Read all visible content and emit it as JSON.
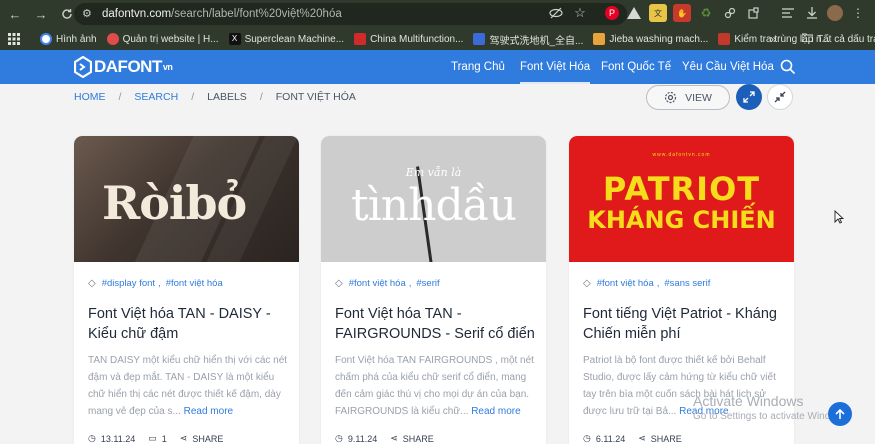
{
  "browser": {
    "url_host": "dafontvn.com",
    "url_path": "/search/label/font%20việt%20hóa",
    "bookmarks": [
      {
        "label": "Hình ảnh",
        "color": "#4caf50"
      },
      {
        "label": "Quản trị website | H...",
        "color": "#e04b4b"
      },
      {
        "label": "Superclean Machine...",
        "color": "#111111"
      },
      {
        "label": "China Multifunction...",
        "color": "#d12a2a"
      },
      {
        "label": "驾驶式洗地机_全自...",
        "color": "#3b6bd8"
      },
      {
        "label": "Jieba washing mach...",
        "color": "#e8a33a"
      },
      {
        "label": "Kiểm tra trùng lặp n...",
        "color": "#c0392b"
      }
    ],
    "bookmarks_more": "»",
    "all_bookmarks": "Tất cả dấu trang"
  },
  "site": {
    "logo_text": "DAFONT",
    "logo_suffix": "vn",
    "menu": [
      {
        "label": "Trang Chủ",
        "active": false
      },
      {
        "label": "Font Việt Hóa",
        "active": true
      },
      {
        "label": "Font Quốc Tế",
        "active": false
      },
      {
        "label": "Yêu Cầu Việt Hóa",
        "active": false
      }
    ]
  },
  "breadcrumb": {
    "home": "HOME",
    "search": "SEARCH",
    "labels": "LABELS",
    "current": "FONT VIỆT HÓA",
    "sep": "/"
  },
  "view_button": "VIEW",
  "cards": [
    {
      "thumb_word": "Ròibỏ",
      "tags": [
        "#display font",
        "#font việt hóa"
      ],
      "title": "Font Việt hóa TAN - DAISY - Kiểu chữ đậm",
      "excerpt": "TAN DAISY  một kiểu chữ hiển thị với các nét đậm và đẹp mắt. TAN - DAISY là một kiểu chữ hiển thị các nét được thiết kế đậm, dày mang vẻ đẹp của s...",
      "read_more": "Read more",
      "date": "13.11.24",
      "comments": "1",
      "share": "SHARE"
    },
    {
      "thumb_script": "Em vẫn là",
      "thumb_word": "tìnhdầu",
      "tags": [
        "#font việt hóa",
        "#serif"
      ],
      "title": "Font Việt hóa TAN - FAIRGROUNDS - Serif cổ điển",
      "excerpt": "Font Việt hóa TAN FAIRGROUNDS , một nét chấm phá của kiểu chữ serif cổ điển, mang đến cảm giác thú vị cho mọi dự án của bạn. FAIRGROUNDS là kiểu chữ...",
      "read_more": "Read more",
      "date": "9.11.24",
      "share": "SHARE"
    },
    {
      "thumb_small": "www.dafontvn.com",
      "thumb_line1": "PATRIOT",
      "thumb_line2": "KHÁNG CHIẾN",
      "tags": [
        "#font việt hóa",
        "#sans serif"
      ],
      "title": "Font tiếng Việt Patriot - Kháng Chiến miễn phí",
      "excerpt": "Patriot là bộ font được thiết kế bởi Behalf Studio, được lấy cảm hứng từ kiểu chữ viết tay trên bìa một cuốn sách bài hát lịch sử được lưu trữ tại Bả...",
      "read_more": "Read more",
      "date": "6.11.24",
      "share": "SHARE"
    }
  ],
  "windows_overlay": {
    "line1": "Activate Windows",
    "line2": "Go to Settings to activate Windows."
  },
  "colors": {
    "brand": "#2f7bde",
    "chrome": "#2f3a2d"
  }
}
